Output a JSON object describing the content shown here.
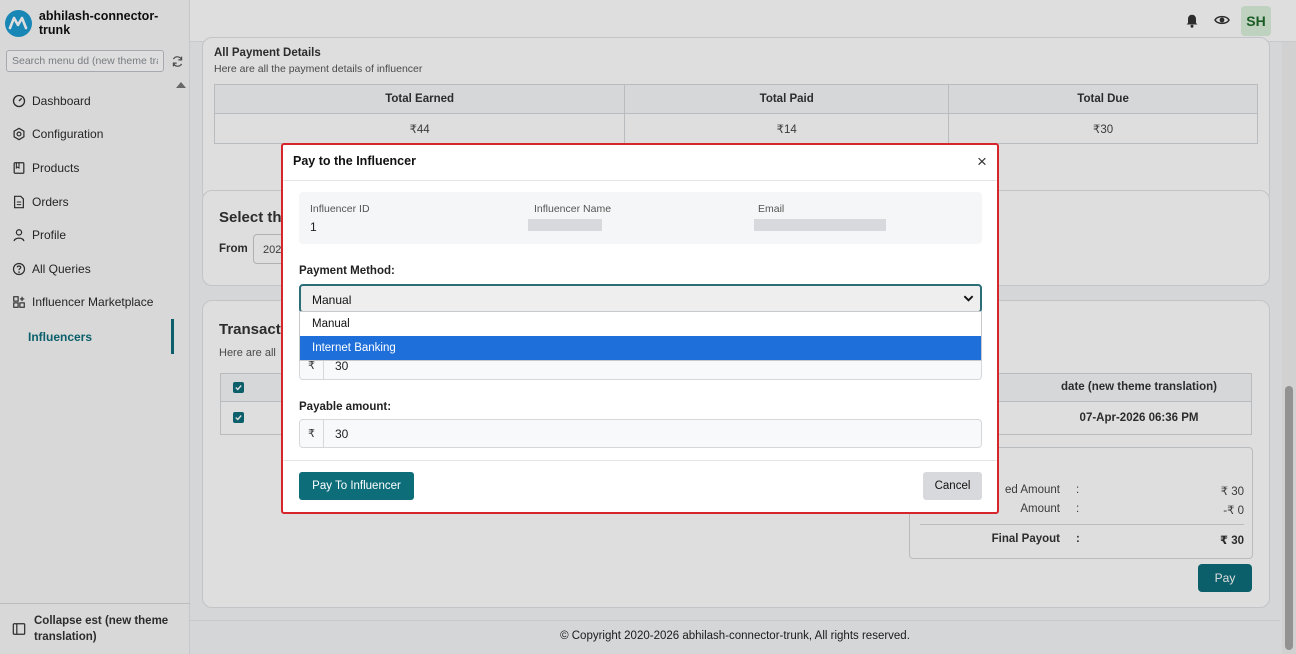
{
  "app": {
    "name": "abhilash-connector-trunk",
    "search_placeholder": "Search menu dd (new theme tra"
  },
  "sidebar": {
    "items": [
      {
        "label": "Dashboard",
        "icon": "dashboard-icon"
      },
      {
        "label": "Configuration",
        "icon": "hexagon-gear-icon"
      },
      {
        "label": "Products",
        "icon": "products-icon"
      },
      {
        "label": "Orders",
        "icon": "orders-icon"
      },
      {
        "label": "Profile",
        "icon": "person-icon"
      },
      {
        "label": "All Queries",
        "icon": "question-icon"
      },
      {
        "label": "Influencer Marketplace",
        "icon": "grid-plus-icon"
      }
    ],
    "sub_active": "Influencers",
    "collapse_label": "Collapse est (new theme translation)"
  },
  "topbar": {
    "avatar_initials": "SH"
  },
  "payment_details": {
    "title": "All Payment Details",
    "subtitle": "Here are all the payment details of influencer",
    "headers": [
      "Total Earned",
      "Total Paid",
      "Total Due"
    ],
    "values": [
      "₹44",
      "₹14",
      "₹30"
    ]
  },
  "select_section": {
    "title": "Select the",
    "from_label": "From",
    "date_partial": "202"
  },
  "transactions": {
    "title": "Transacti",
    "subtitle": "Here are all",
    "date_header": "date (new theme translation)",
    "row_date": "07-Apr-2026 06:36 PM",
    "summary": [
      {
        "label": "ed Amount",
        "colon": ":",
        "value": "₹ 30"
      },
      {
        "label": "Amount",
        "colon": ":",
        "value": "-₹ 0"
      },
      {
        "label": "Final Payout",
        "colon": ":",
        "value": "₹ 30"
      }
    ],
    "pay_label": "Pay"
  },
  "footer": {
    "text": "© Copyright 2020-2026 abhilash-connector-trunk, All rights reserved."
  },
  "modal": {
    "title": "Pay to the Influencer",
    "close_glyph": "×",
    "influencer_id_label": "Influencer ID",
    "influencer_id": "1",
    "influencer_name_label": "Influencer Name",
    "email_label": "Email",
    "payment_method_label": "Payment Method:",
    "payment_method_value": "Manual",
    "payment_method_options": [
      "Manual",
      "Internet Banking"
    ],
    "highlighted_option": "Internet Banking",
    "currency_symbol": "₹",
    "amount_value": "30",
    "payable_amount_label": "Payable amount:",
    "payable_amount_value": "30",
    "pay_button": "Pay To Influencer",
    "cancel_button": "Cancel"
  },
  "colors": {
    "accent": "#0d6e7a",
    "modal_border": "#d6252b",
    "dropdown_highlight": "#1e6fd9",
    "logo": "#1d9bd1"
  }
}
